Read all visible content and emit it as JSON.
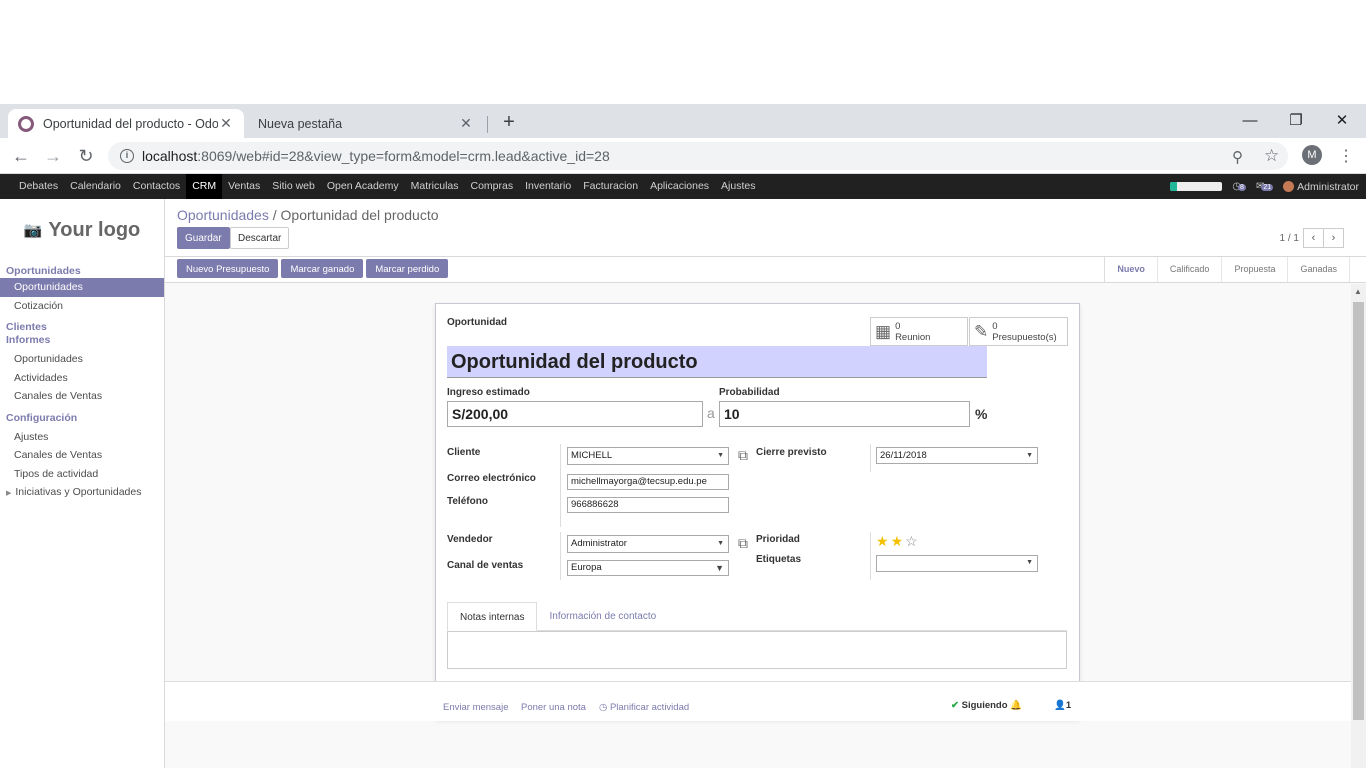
{
  "browser": {
    "tabs": [
      {
        "title": "Oportunidad del producto - Odoo",
        "close": "✕"
      },
      {
        "title": "Nueva pestaña",
        "close": "✕"
      }
    ],
    "new_tab": "+",
    "window": {
      "minimize": "—",
      "restore": "❐",
      "close": "✕"
    },
    "nav": {
      "back": "←",
      "forward": "→",
      "reload": "↻"
    },
    "url_host": "localhost",
    "url_path": ":8069/web#id=28&view_type=form&model=crm.lead&active_id=28",
    "zoom_icon": "⚲",
    "star_icon": "☆",
    "profile_initial": "M",
    "menu_icon": "⋮"
  },
  "topnav": {
    "items": [
      "Debates",
      "Calendario",
      "Contactos",
      "CRM",
      "Ventas",
      "Sitio web",
      "Open Academy",
      "Matriculas",
      "Compras",
      "Inventario",
      "Facturacion",
      "Aplicaciones",
      "Ajustes"
    ],
    "active": "CRM",
    "activity_count": "8",
    "message_count": "21",
    "progress_fraction": 0.12,
    "user": "Administrator"
  },
  "sidebar": {
    "logo": "Your logo",
    "logo_icon": "📷",
    "sections": [
      {
        "title": "Oportunidades",
        "items": [
          "Oportunidades",
          "Cotización"
        ]
      },
      {
        "title": "Clientes",
        "items": []
      },
      {
        "title": "Informes",
        "items": [
          "Oportunidades",
          "Actividades",
          "Canales de Ventas"
        ]
      },
      {
        "title": "Configuración",
        "items": [
          "Ajustes",
          "Canales de Ventas",
          "Tipos de actividad"
        ]
      }
    ],
    "collapsible_item": "Iniciativas y Oportunidades",
    "active_item": "Oportunidades"
  },
  "control_panel": {
    "breadcrumb_parent": "Oportunidades",
    "breadcrumb_sep": " / ",
    "breadcrumb_current": "Oportunidad del producto",
    "save": "Guardar",
    "discard": "Descartar",
    "pager": "1 / 1",
    "prev": "‹",
    "next": "›"
  },
  "statusbar": {
    "buttons": [
      "Nuevo Presupuesto",
      "Marcar ganado",
      "Marcar perdido"
    ],
    "stages": [
      "Nuevo",
      "Calificado",
      "Propuesta",
      "Ganadas"
    ],
    "current_stage": "Nuevo"
  },
  "form": {
    "title_label": "Oportunidad",
    "name": "Oportunidad del producto",
    "smart_buttons": [
      {
        "count": "0",
        "label": "Reunion",
        "icon": "calendar-icon"
      },
      {
        "count": "0",
        "label": "Presupuesto(s)",
        "icon": "edit-icon"
      }
    ],
    "expected_revenue_label": "Ingreso estimado",
    "expected_revenue": "S/200,00",
    "at": "a",
    "probability_label": "Probabilidad",
    "probability": "10",
    "percent": "%",
    "customer_label": "Cliente",
    "customer": "MICHELL",
    "email_label": "Correo electrónico",
    "email": "michellmayorga@tecsup.edu.pe",
    "phone_label": "Teléfono",
    "phone": "966886628",
    "deadline_label": "Cierre previsto",
    "deadline": "26/11/2018",
    "salesperson_label": "Vendedor",
    "salesperson": "Administrator",
    "team_label": "Canal de ventas",
    "team": "Europa",
    "priority_label": "Prioridad",
    "priority_stars": 2,
    "priority_max": 3,
    "tags_label": "Etiquetas",
    "tags": "",
    "tabs": [
      "Notas internas",
      "Información de contacto"
    ],
    "active_tab": "Notas internas",
    "notes": ""
  },
  "chatter": {
    "send_message": "Enviar mensaje",
    "log_note": "Poner una nota",
    "schedule": "Planificar actividad",
    "following": "Siguiendo",
    "followers": "1"
  }
}
